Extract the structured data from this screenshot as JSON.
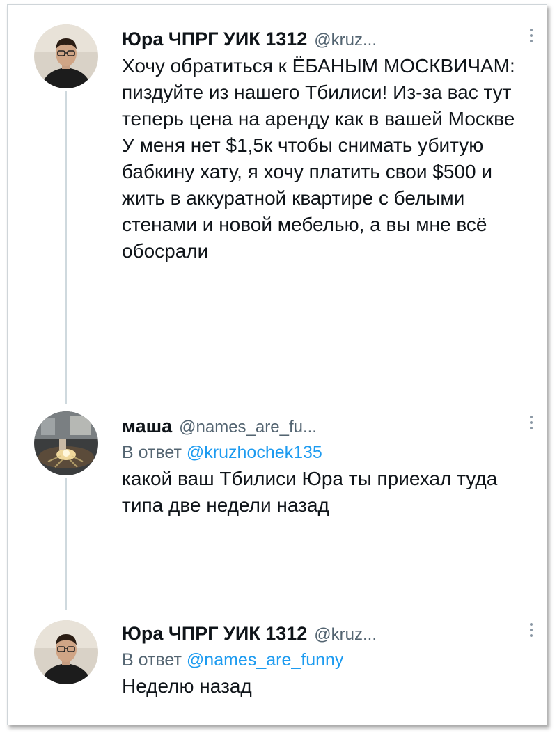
{
  "tweets": [
    {
      "name": "Юра ЧПРГ УИК 1312",
      "handle": "@kruz...",
      "text": "Хочу обратиться к ЁБАНЫМ МОСКВИЧАМ: пиздуйте из нашего Тбилиси! Из-за вас тут теперь цена на аренду как в вашей Москве\nУ меня нет $1,5к чтобы снимать убитую бабкину хату, я хочу платить свои $500 и жить в аккуратной квартире с белыми стенами и новой мебелью, а вы мне всё обосрали"
    },
    {
      "name": "маша",
      "handle": "@names_are_fu...",
      "reply_prefix": "В ответ",
      "reply_mention": "@kruzhochek135",
      "text": "какой ваш Тбилиси Юра ты приехал туда типа две недели назад"
    },
    {
      "name": "Юра ЧПРГ УИК 1312",
      "handle": "@kruz...",
      "reply_prefix": "В ответ",
      "reply_mention": "@names_are_funny",
      "text": "Неделю назад"
    }
  ],
  "icons": {
    "more": "more-vertical-icon",
    "avatar_yura": "avatar-man-glasses",
    "avatar_masha": "avatar-candle-photo"
  },
  "colors": {
    "mention": "#1d9bf0",
    "secondary": "#536471",
    "thread": "#cfd9de"
  }
}
